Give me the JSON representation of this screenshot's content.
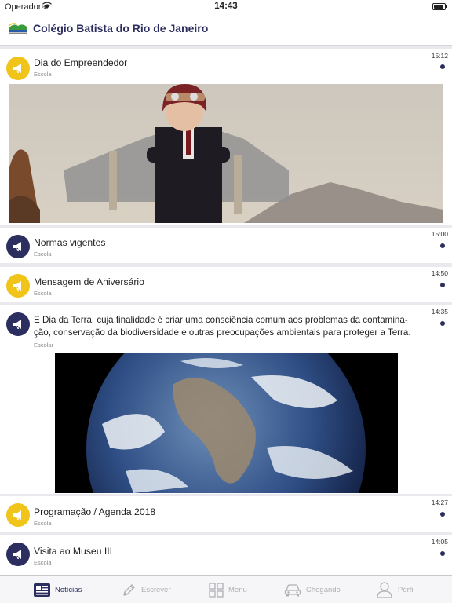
{
  "status_bar": {
    "carrier": "Operadora",
    "time": "14:43"
  },
  "header": {
    "title": "Colégio Batista do Rio de Janeiro"
  },
  "posts": [
    {
      "time": "15:12",
      "title": "Dia do Empreendedor",
      "category": "Escola",
      "avatar_color": "#f0c419"
    },
    {
      "time": "15:00",
      "title": "Normas vigentes",
      "category": "Escola",
      "avatar_color": "#2b2e5e"
    },
    {
      "time": "14:50",
      "title": "Mensagem de Aniversário",
      "category": "Escola",
      "avatar_color": "#f0c419"
    },
    {
      "time": "14:35",
      "title": "E Dia da Terra, cuja finalidade é criar uma consciência comum aos problemas da contamina-ção, conservação da biodiversidade e outras preocupações ambientais para proteger a Terra.",
      "title_line1": "E Dia da Terra, cuja finalidade é criar uma consciência comum aos problemas da contamina-",
      "title_line2": "ção, conservação da biodiversidade e outras preocupações ambientais para proteger a Terra.",
      "category": "Escolar",
      "avatar_color": "#2b2e5e"
    },
    {
      "time": "14:27",
      "title": "Programação / Agenda 2018",
      "category": "Escola",
      "avatar_color": "#f0c419"
    },
    {
      "time": "14:05",
      "title": "Visita ao Museu III",
      "category": "Escola",
      "avatar_color": "#2b2e5e"
    }
  ],
  "tabs": [
    {
      "label": "Notícias",
      "icon": "news-icon",
      "active": true
    },
    {
      "label": "Escrever",
      "icon": "pencil-icon",
      "active": false
    },
    {
      "label": "Menu",
      "icon": "grid-icon",
      "active": false
    },
    {
      "label": "Chegando",
      "icon": "car-icon",
      "active": false
    },
    {
      "label": "Perfil",
      "icon": "person-icon",
      "active": false
    }
  ],
  "colors": {
    "accent": "#2b2e5e",
    "yellow": "#f0c419",
    "inactive_tab": "#b0b0b4"
  }
}
